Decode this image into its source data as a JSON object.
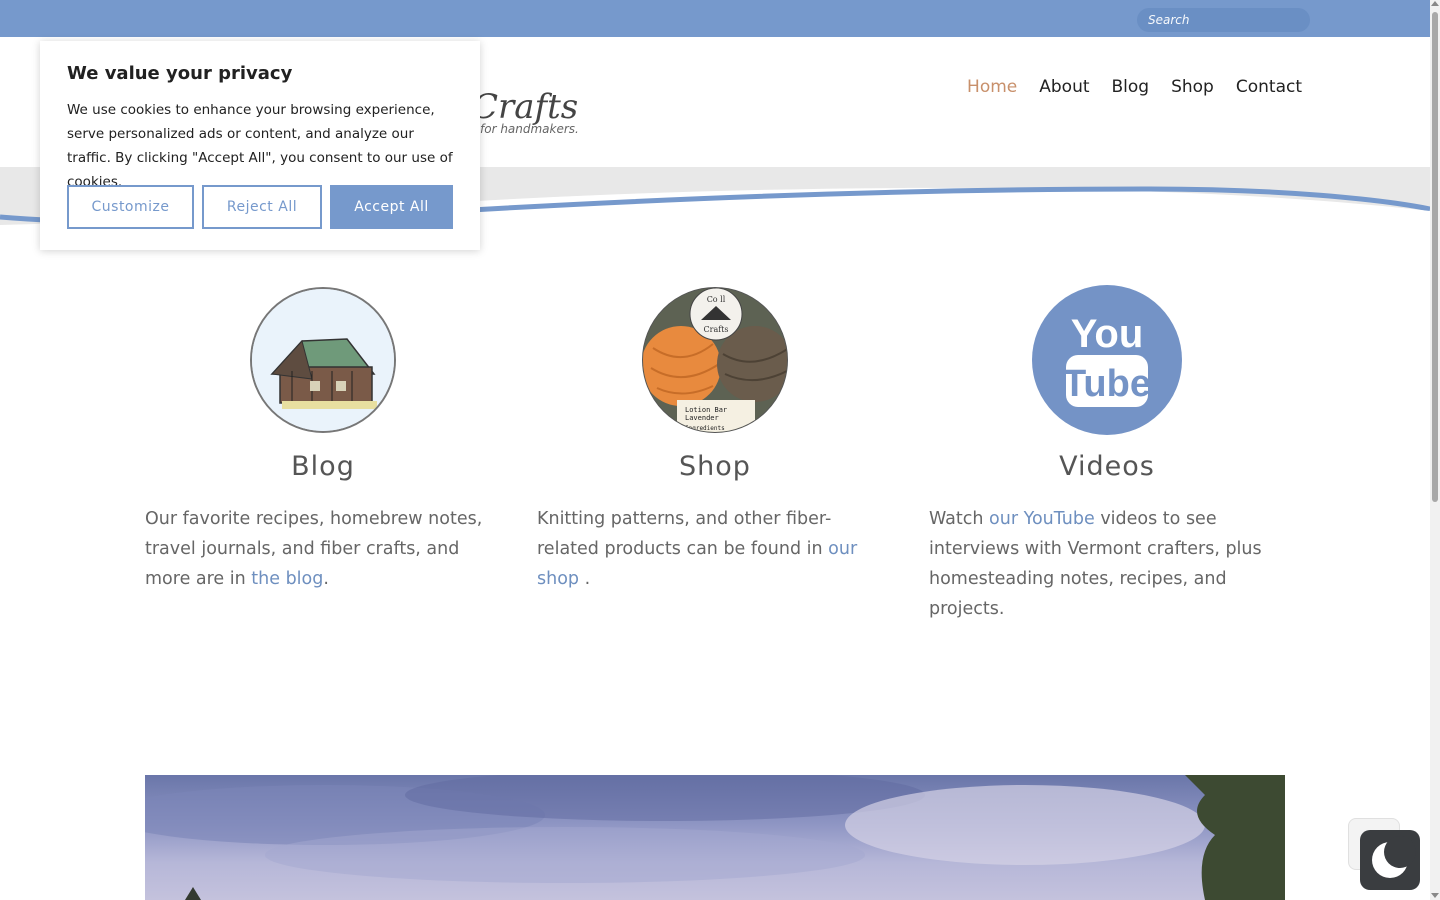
{
  "search": {
    "placeholder": "Search"
  },
  "logo": {
    "text": "Crafts",
    "tagline": "for handmakers."
  },
  "nav": {
    "items": [
      {
        "label": "Home",
        "active": true
      },
      {
        "label": "About"
      },
      {
        "label": "Blog"
      },
      {
        "label": "Shop"
      },
      {
        "label": "Contact"
      }
    ]
  },
  "colors": {
    "accent": "#7699cc",
    "nav_active": "#c8906b",
    "link": "#6e8fbf"
  },
  "columns": [
    {
      "title": "Blog",
      "icon": "barn-drawing-icon",
      "text_before": "Our favorite recipes, homebrew notes, travel journals, and fiber crafts, and more are in ",
      "link": "the blog",
      "text_after": "."
    },
    {
      "title": "Shop",
      "icon": "yarn-products-photo",
      "text_before": "Knitting patterns, and other fiber-related products can be found in ",
      "link": "our shop",
      "text_after": " ."
    },
    {
      "title": "Videos",
      "icon": "youtube-icon",
      "text_before": "Watch ",
      "link": "our YouTube",
      "text_after": " videos to see interviews with Vermont crafters, plus homesteading notes, recipes, and projects."
    }
  ],
  "youtube_logo": {
    "line1": "You",
    "line2": "Tube"
  },
  "shop_photo_labels": {
    "circle_top": "Co  ll",
    "circle_bottom": "Crafts",
    "label_line1": "Lotion Bar",
    "label_line2": "Lavender",
    "label_line3": "Ingredients"
  },
  "cookie": {
    "title": "We value your privacy",
    "body": "We use cookies to enhance your browsing experience, serve personalized ads or content, and analyze our traffic. By clicking \"Accept All\", you consent to our use of cookies.",
    "customize": "Customize",
    "reject": "Reject All",
    "accept": "Accept All"
  }
}
